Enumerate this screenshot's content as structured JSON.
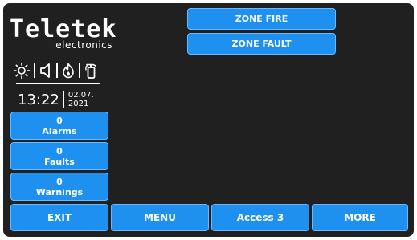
{
  "logo": {
    "main": "Teletek",
    "sub": "electronics"
  },
  "status_icons": [
    "sun-icon",
    "speaker-icon",
    "fire-flame-icon",
    "fire-extinguisher-icon"
  ],
  "clock": {
    "time": "13:22",
    "date_day_month": "02.07.",
    "date_year": "2021"
  },
  "zone_buttons": {
    "fire_label": "ZONE FIRE",
    "fault_label": "ZONE FAULT"
  },
  "counters": [
    {
      "count": "0",
      "label": "Alarms"
    },
    {
      "count": "0",
      "label": "Faults"
    },
    {
      "count": "0",
      "label": "Warnings"
    }
  ],
  "bottom_bar": {
    "exit_label": "EXIT",
    "menu_label": "MENU",
    "access_label": "Access 3",
    "more_label": "MORE"
  },
  "colors": {
    "background": "#202020",
    "button": "#1e90f0",
    "button_border": "#6ab8ff",
    "text": "#ffffff"
  }
}
